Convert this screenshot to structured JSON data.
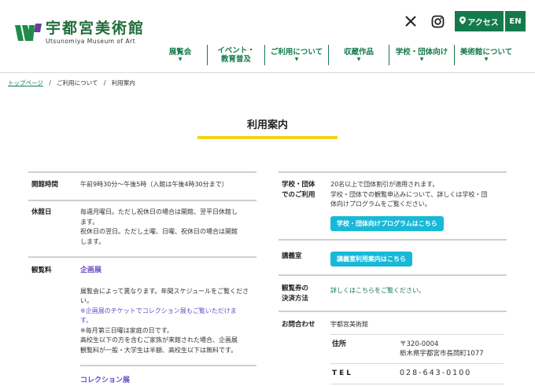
{
  "header": {
    "logo_jp": "宇都宮美術館",
    "logo_en": "Utsunomiya Museum of Art",
    "access_label": "アクセス",
    "en_label": "EN"
  },
  "nav": [
    {
      "line1": "展覧会",
      "line2": ""
    },
    {
      "line1": "イベント・",
      "line2": "教育普及"
    },
    {
      "line1": "ご利用について",
      "line2": ""
    },
    {
      "line1": "収蔵作品",
      "line2": ""
    },
    {
      "line1": "学校・団体向け",
      "line2": ""
    },
    {
      "line1": "美術館について",
      "line2": ""
    }
  ],
  "breadcrumb": {
    "home": "トップページ",
    "parent": "ご利用について",
    "current": "利用案内",
    "separator": "/"
  },
  "page_title": "利用案内",
  "left": {
    "hours": {
      "label": "開館時間",
      "text": "午前9時30分～午後5時（入館は午後4時30分まで）"
    },
    "closed": {
      "label": "休館日",
      "lines": [
        "毎週月曜日。ただし祝休日の場合は開館、翌平日休館し",
        "ます。",
        "祝休日の翌日。ただし土曜、日曜、祝休日の場合は開館",
        "します。"
      ]
    },
    "fees": {
      "label": "観覧料",
      "special_heading": "企画展",
      "special_lines": [
        "展覧会によって異なります。年間スケジュールをご覧くださ",
        "い。"
      ],
      "special_note_lines": [
        "※企画展のチケットでコレクション展もご覧いただけま",
        "す。"
      ],
      "special_lines2": [
        "※毎月第三日曜は家庭の日です。",
        "高校生以下の方を含むご家族が来館された場合、企画展",
        "観覧料が一般・大学生は半額、高校生以下は無料です。"
      ],
      "collection_heading": "コレクション展"
    }
  },
  "right": {
    "groups": {
      "label_line1": "学校・団体",
      "label_line2": "でのご利用",
      "lines": [
        "20名以上で団体割引が適用されます。",
        "学校・団体での観覧申込みについて、詳しくは学校・団",
        "体向けプログラムをご覧ください。"
      ],
      "button": "学校・団体向けプログラムはこちら"
    },
    "lecture": {
      "label": "講義室",
      "button": "講義室利用案内はこちら"
    },
    "payment": {
      "label_line1": "観覧券の",
      "label_line2": "決済方法",
      "link": "詳しくはこちらをご覧ください。"
    },
    "contact": {
      "label": "お問合わせ",
      "org": "宇都宮美術館",
      "address_label": "住所",
      "postal": "〒320-0004",
      "address": "栃木県宇都宮市長岡町1077",
      "tel_label": "TEL",
      "tel": "028-643-0100"
    }
  },
  "colors": {
    "green": "#147a4c",
    "yellow": "#f2d41c",
    "cyan": "#18b8d8",
    "purple": "#6a4bc4"
  }
}
